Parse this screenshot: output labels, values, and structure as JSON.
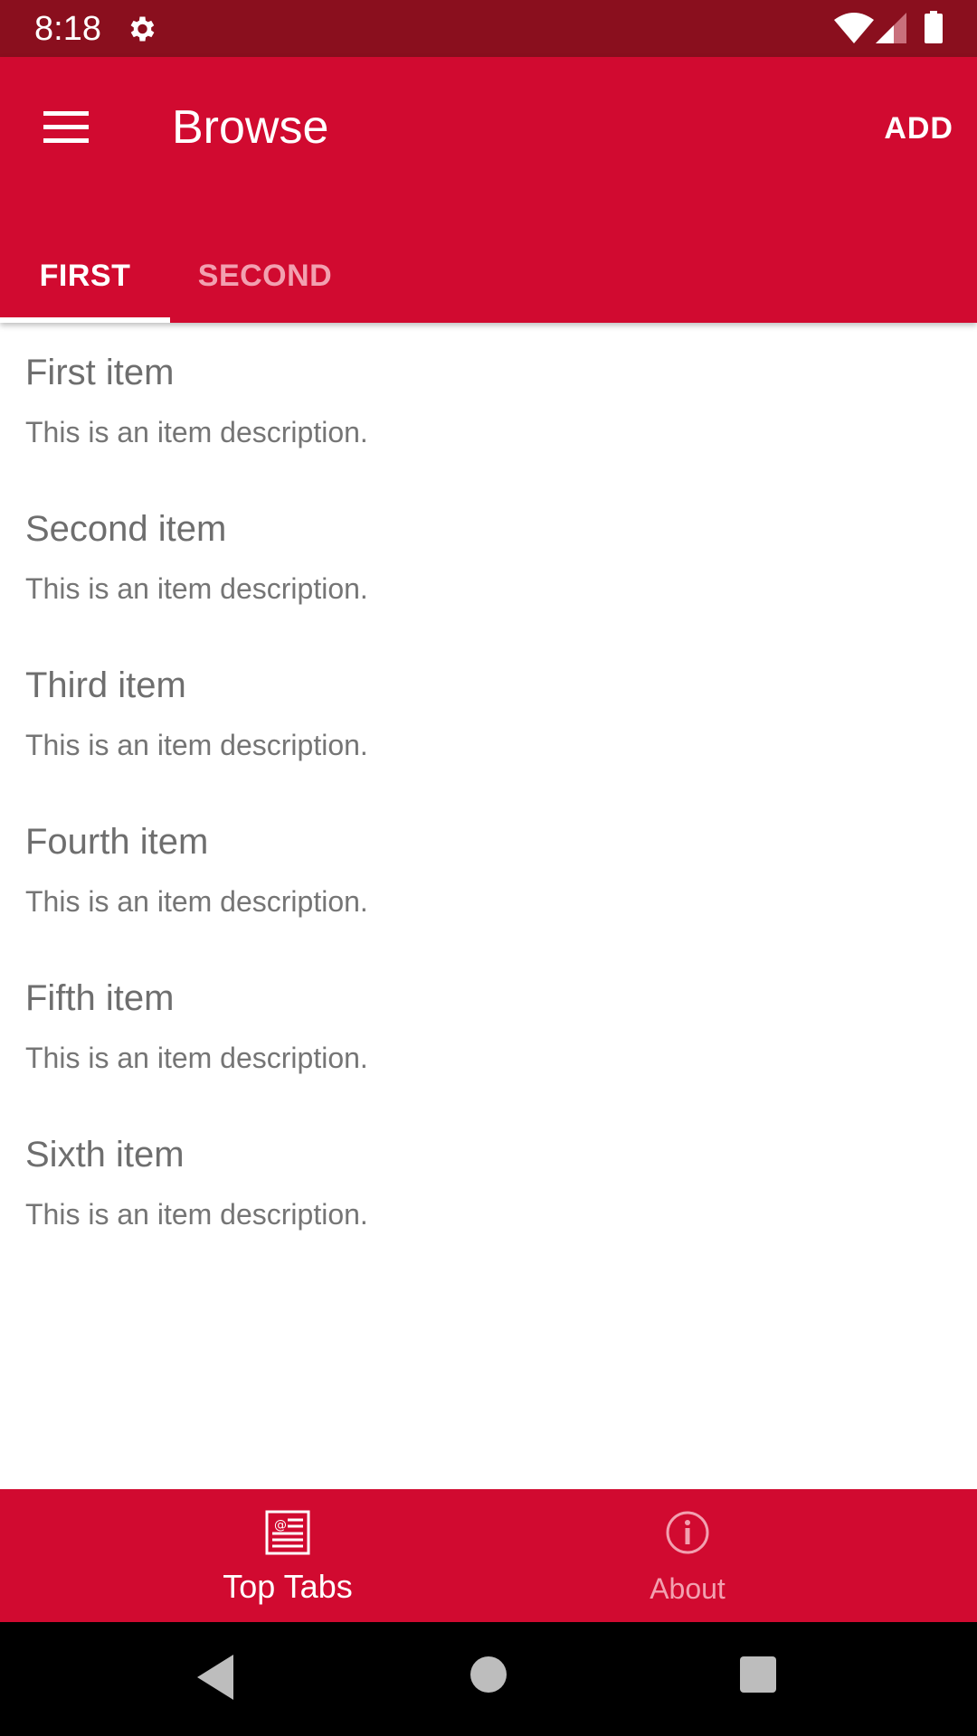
{
  "status_bar": {
    "time": "8:18",
    "icons": [
      "settings-icon",
      "wifi-icon",
      "signal-icon",
      "battery-icon"
    ]
  },
  "app_bar": {
    "title": "Browse",
    "action_label": "ADD",
    "menu_icon": "hamburger-menu-icon"
  },
  "tabs": [
    {
      "label": "FIRST",
      "selected": true
    },
    {
      "label": "SECOND",
      "selected": false
    }
  ],
  "items": [
    {
      "title": "First item",
      "description": "This is an item description."
    },
    {
      "title": "Second item",
      "description": "This is an item description."
    },
    {
      "title": "Third item",
      "description": "This is an item description."
    },
    {
      "title": "Fourth item",
      "description": "This is an item description."
    },
    {
      "title": "Fifth item",
      "description": "This is an item description."
    },
    {
      "title": "Sixth item",
      "description": "This is an item description."
    }
  ],
  "bottom_nav": [
    {
      "label": "Top Tabs",
      "icon": "newspaper-icon",
      "selected": true
    },
    {
      "label": "About",
      "icon": "info-icon",
      "selected": false
    }
  ],
  "colors": {
    "primary": "#d10a30",
    "status_bar": "#8a0f1e",
    "inactive_tab": "#f2a0b0",
    "item_text": "#6e6e6e"
  }
}
